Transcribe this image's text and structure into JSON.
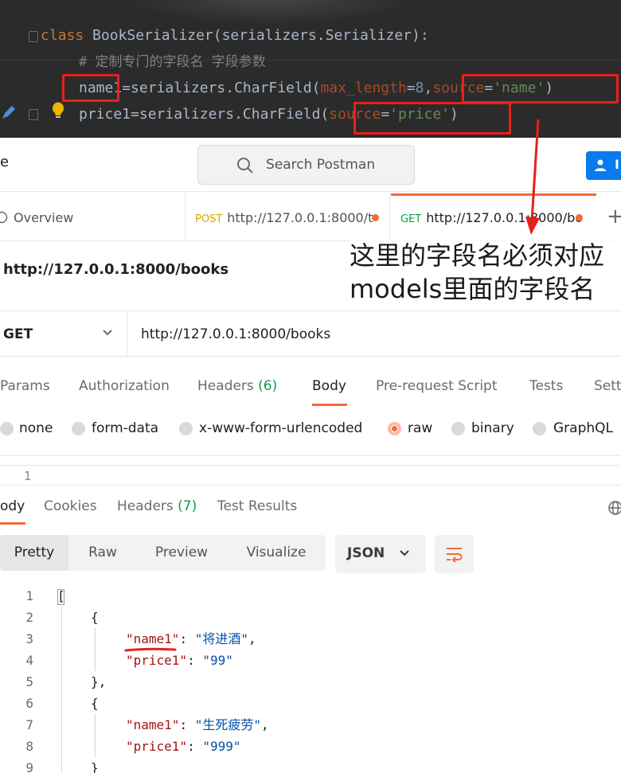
{
  "ide": {
    "line1": {
      "kw": "class",
      "name": " BookSerializer(serializers.Serializer):"
    },
    "line2": {
      "comment": "# 定制专门的字段名 字段参数"
    },
    "line3": {
      "field": "name1",
      "eq": "=serializers.CharField(",
      "param1": "max_length",
      "eq2": "=",
      "num": "8",
      "comma": ",",
      "param2": "source",
      "eq3": "=",
      "str": "'name'",
      "close": ")"
    },
    "line4": {
      "field": "price1",
      "eq": "=serializers.CharField(",
      "param": "source",
      "eq2": "=",
      "str": "'price'",
      "close": ")"
    },
    "annotation_color": "#e8201b"
  },
  "postman": {
    "topbar": {
      "left_cut_text": "e",
      "search_placeholder": "Search Postman",
      "invite_label": "I"
    },
    "tabs": [
      {
        "label": "Overview"
      },
      {
        "method": "POST",
        "label": "http://127.0.0.1:8000/t"
      },
      {
        "method": "GET",
        "label": "http://127.0.0.1:8000/bo"
      }
    ],
    "new_tab": "+",
    "request_title": "http://127.0.0.1:8000/books",
    "method": "GET",
    "url": "http://127.0.0.1:8000/books",
    "request_tabs": {
      "params": "Params",
      "authorization": "Authorization",
      "headers": "Headers",
      "headers_count": "(6)",
      "body": "Body",
      "prerequest": "Pre-request Script",
      "tests": "Tests",
      "settings": "Sett"
    },
    "body_types": [
      "none",
      "form-data",
      "x-www-form-urlencoded",
      "raw",
      "binary",
      "GraphQL"
    ],
    "body_type_selected": "raw",
    "editor_line": "1",
    "response_tabs": {
      "body": "ody",
      "cookies": "Cookies",
      "headers": "Headers",
      "headers_count": "(7)",
      "test_results": "Test Results"
    },
    "view_modes": [
      "Pretty",
      "Raw",
      "Preview",
      "Visualize"
    ],
    "view_mode_selected": "Pretty",
    "format": "JSON",
    "response": {
      "lines": [
        {
          "n": "1",
          "text": "["
        },
        {
          "n": "2",
          "text": "{"
        },
        {
          "n": "3",
          "key": "\"name1\"",
          "value": "\"将进酒\""
        },
        {
          "n": "4",
          "key": "\"price1\"",
          "value": "\"99\""
        },
        {
          "n": "5",
          "text": "},"
        },
        {
          "n": "6",
          "text": "{"
        },
        {
          "n": "7",
          "key": "\"name1\"",
          "value": "\"生死疲劳\""
        },
        {
          "n": "8",
          "key": "\"price1\"",
          "value": "\"999\""
        },
        {
          "n": "9",
          "text": "}"
        }
      ]
    },
    "accent_color": "#f26b3a"
  },
  "annotation": {
    "note": "这里的字段名必须对应models里面的字段名"
  }
}
